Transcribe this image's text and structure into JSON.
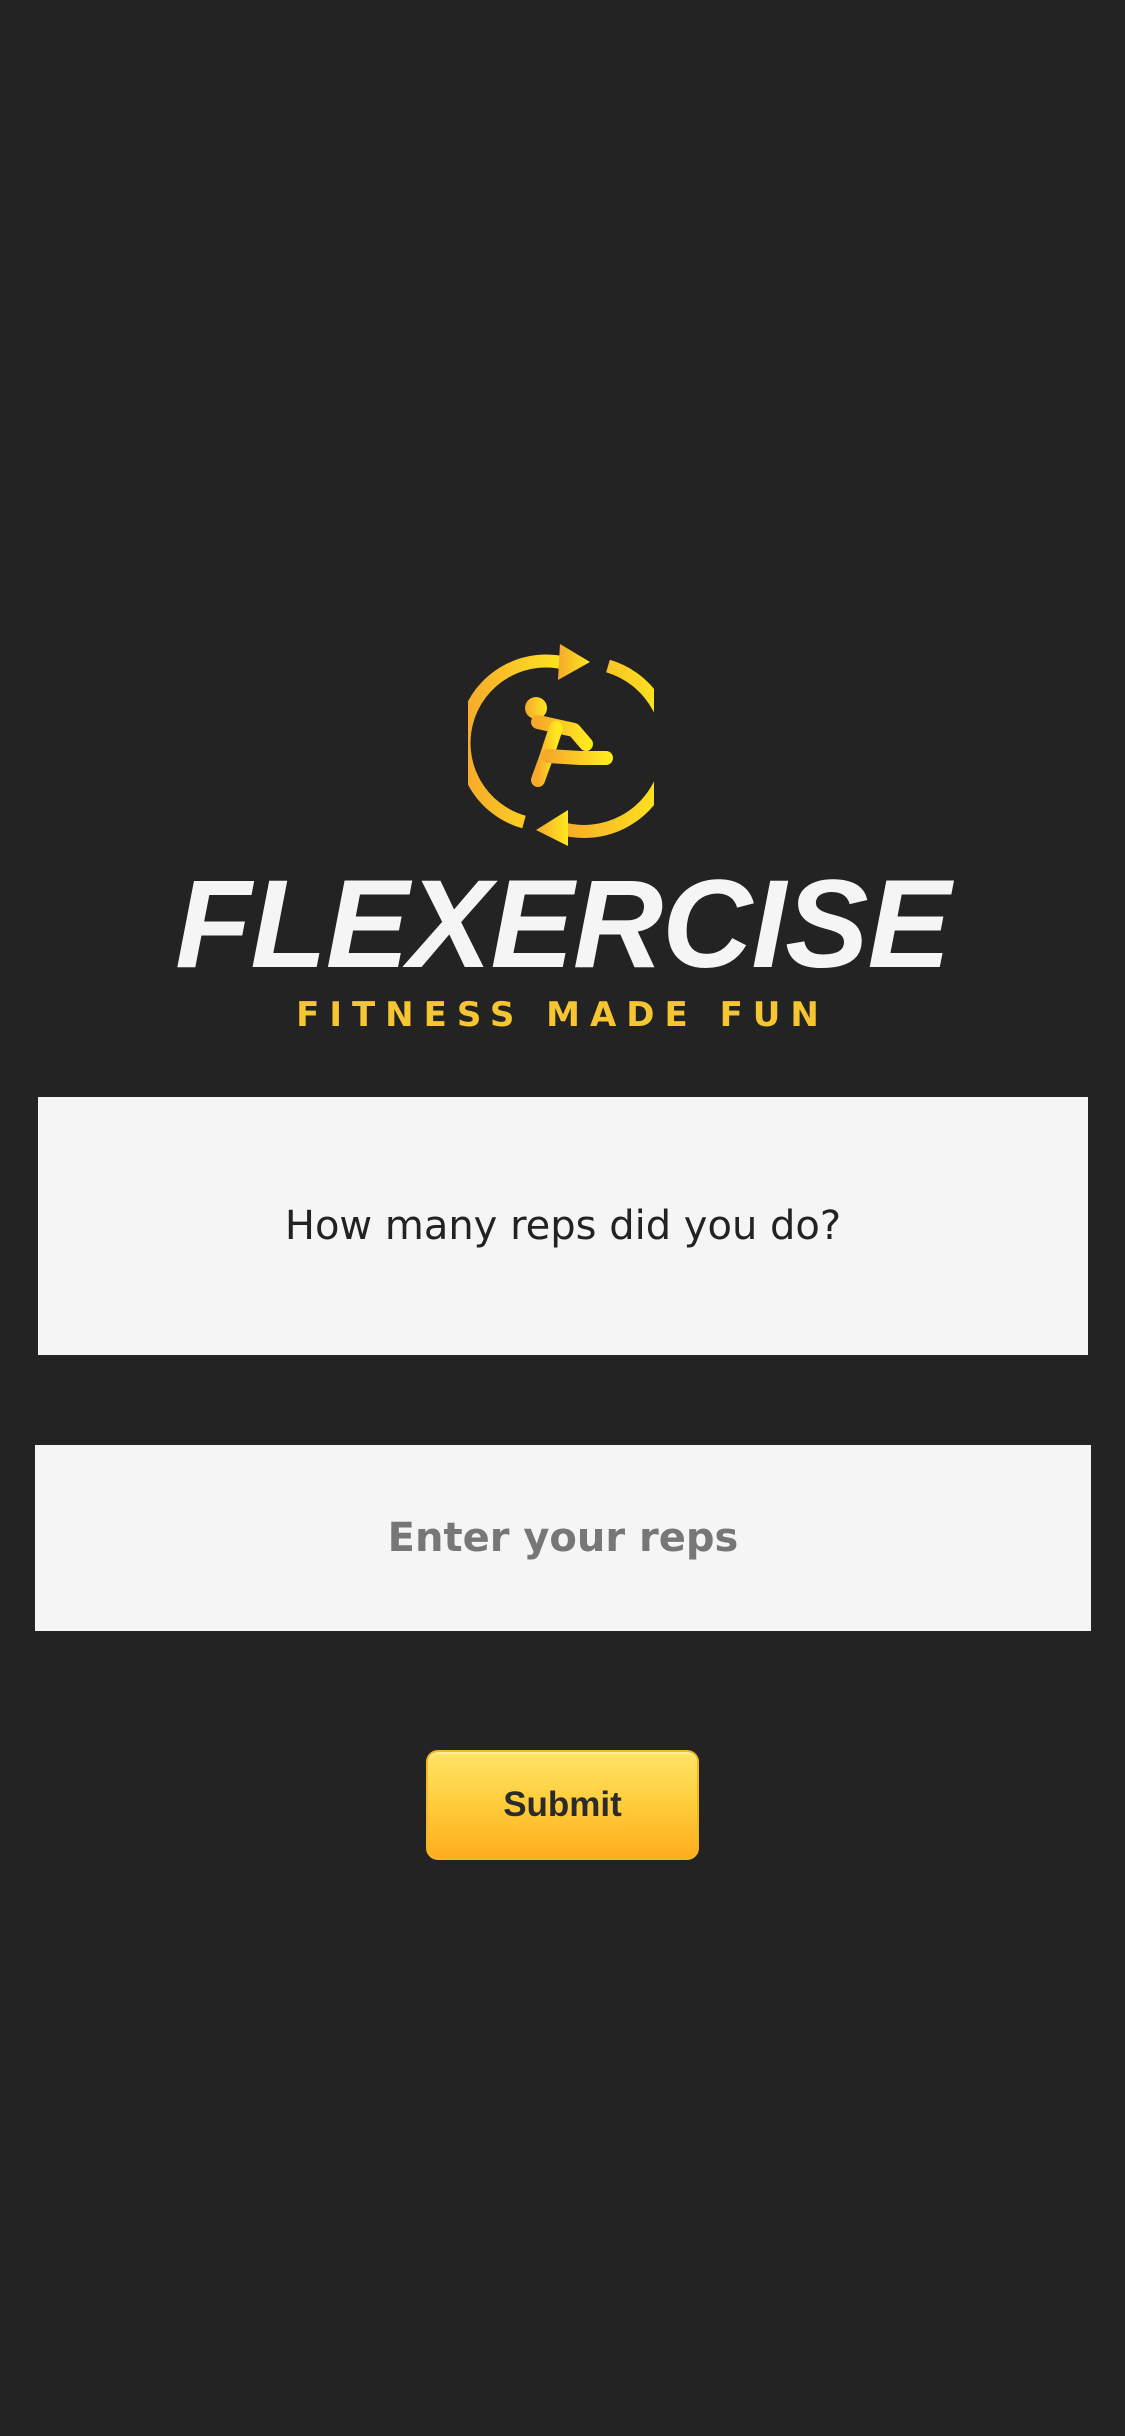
{
  "brand": {
    "name": "FLEXERCISE",
    "tagline": "FITNESS MADE FUN",
    "logo_icon": "running-person-cycle-icon",
    "accent_color": "#f7c531",
    "gradient_colors": [
      "#f6a92b",
      "#ffe81f"
    ]
  },
  "question": {
    "text": "How many reps did you do?"
  },
  "reps_input": {
    "placeholder": "Enter your reps",
    "value": ""
  },
  "submit": {
    "label": "Submit",
    "color_top": "#ffe466",
    "color_bottom": "#ffad1d"
  },
  "colors": {
    "background": "#232323",
    "card": "#f5f5f5"
  }
}
